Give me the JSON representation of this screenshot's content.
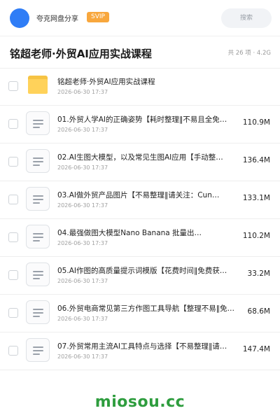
{
  "header": {
    "brand": "夸克网盘分享",
    "badge": "SVIP",
    "search_placeholder": "搜索"
  },
  "share": {
    "title": "铭超老师·外贸AI应用实战课程",
    "meta": "共 26 项 · 4.2G"
  },
  "items": [
    {
      "type": "folder",
      "name": "铭超老师·外贸AI应用实战课程",
      "date": "2026-06-30 17:37",
      "size": ""
    },
    {
      "type": "doc",
      "name": "01.外贸人学AI的正确姿势【耗时整理‖不易且全免…",
      "date": "2026-06-30 17:37",
      "size": "110.9M"
    },
    {
      "type": "doc",
      "name": "02.AI生图大模型，以及常见生图AI应用【手动整…",
      "date": "2026-06-30 17:37",
      "size": "136.4M"
    },
    {
      "type": "doc",
      "name": "03.AI做外贸产品图片【不易整理‖请关注：Cun…",
      "date": "2026-06-30 17:37",
      "size": "133.1M"
    },
    {
      "type": "doc",
      "name": "04.最强做图大模型Nano Banana 批量出…",
      "date": "2026-06-30 17:37",
      "size": "110.2M"
    },
    {
      "type": "doc",
      "name": "05.AI作图的高质量提示词模版【花费时间‖免费获…",
      "date": "2026-06-30 17:37",
      "size": "33.2M"
    },
    {
      "type": "doc",
      "name": "06.外贸电商常见第三方作图工具导航【整理不易‖免…",
      "date": "2026-06-30 17:37",
      "size": "68.6M"
    },
    {
      "type": "doc",
      "name": "07.外贸常用主流AI工具特点与选择【不易整理‖请…",
      "date": "2026-06-30 17:37",
      "size": "147.4M"
    }
  ],
  "watermark": "miosou.cc",
  "colors": {
    "avatar": "#2f7df6",
    "svip_badge": "#f8a73d",
    "folder": "#ffd25a",
    "watermark": "#2e9d3e"
  }
}
